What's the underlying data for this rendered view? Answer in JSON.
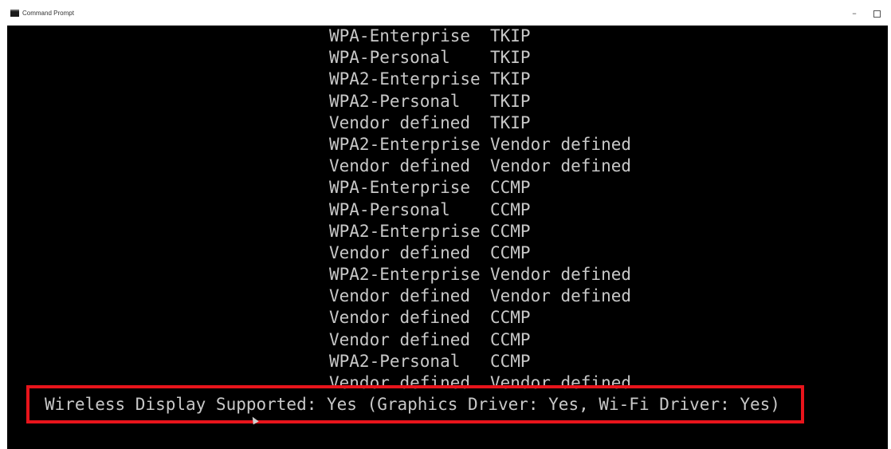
{
  "window": {
    "title": "Command Prompt",
    "controls": {
      "minimize": "–"
    }
  },
  "console": {
    "lines": [
      {
        "auth": "WPA-Enterprise",
        "cipher": "TKIP"
      },
      {
        "auth": "WPA-Personal",
        "cipher": "TKIP"
      },
      {
        "auth": "WPA2-Enterprise",
        "cipher": "TKIP"
      },
      {
        "auth": "WPA2-Personal",
        "cipher": "TKIP"
      },
      {
        "auth": "Vendor defined",
        "cipher": "TKIP"
      },
      {
        "auth": "WPA2-Enterprise",
        "cipher": "Vendor defined"
      },
      {
        "auth": "Vendor defined",
        "cipher": "Vendor defined"
      },
      {
        "auth": "WPA-Enterprise",
        "cipher": "CCMP"
      },
      {
        "auth": "WPA-Personal",
        "cipher": "CCMP"
      },
      {
        "auth": "WPA2-Enterprise",
        "cipher": "CCMP"
      },
      {
        "auth": "Vendor defined",
        "cipher": "CCMP"
      },
      {
        "auth": "WPA2-Enterprise",
        "cipher": "Vendor defined"
      },
      {
        "auth": "Vendor defined",
        "cipher": "Vendor defined"
      },
      {
        "auth": "Vendor defined",
        "cipher": "CCMP"
      },
      {
        "auth": "Vendor defined",
        "cipher": "CCMP"
      },
      {
        "auth": "WPA2-Personal",
        "cipher": "CCMP"
      },
      {
        "auth": "Vendor defined",
        "cipher": "Vendor defined"
      }
    ],
    "highlighted_line": "Wireless Display Supported: Yes (Graphics Driver: Yes, Wi-Fi Driver: Yes)"
  },
  "colors": {
    "console_background": "#000000",
    "console_text": "#c8c8c8",
    "highlight_border": "#e8141b"
  },
  "icons": {
    "app": "command-prompt-icon",
    "minimize": "minimize-icon",
    "maximize": "maximize-icon",
    "cursor": "mouse-pointer-icon"
  }
}
